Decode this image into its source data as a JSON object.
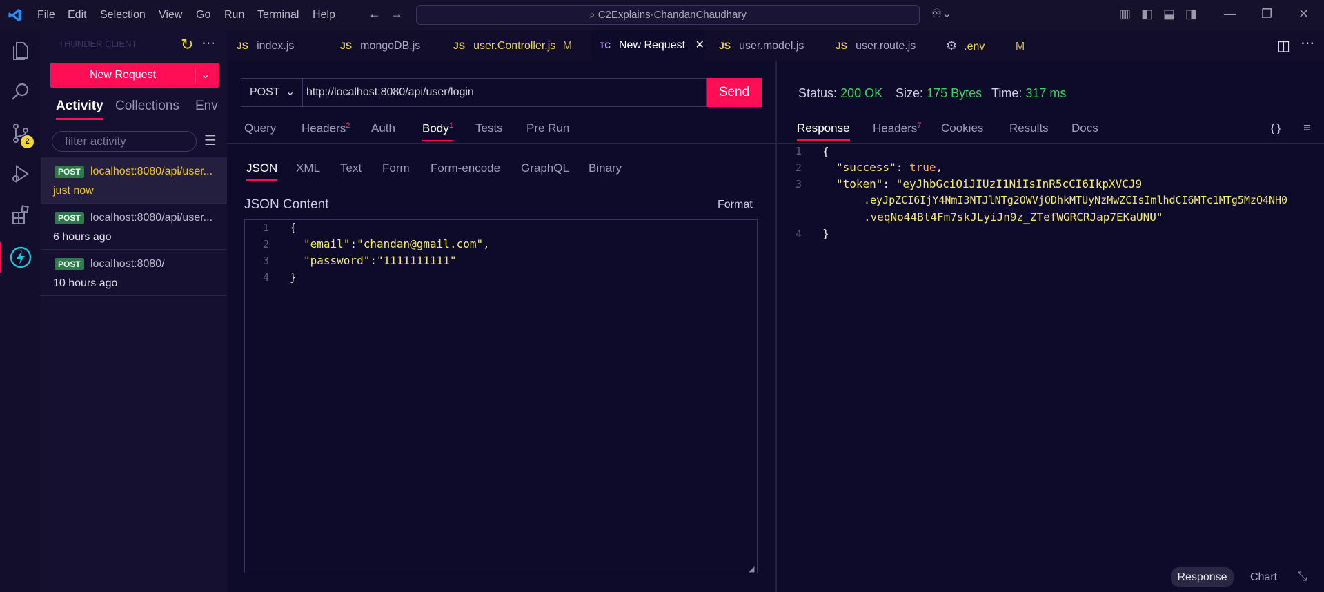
{
  "titlebar": {
    "menus": [
      "File",
      "Edit",
      "Selection",
      "View",
      "Go",
      "Run",
      "Terminal",
      "Help"
    ],
    "search": "C2Explains-ChandanChaudhary"
  },
  "activitybar": {
    "icons": [
      "files-icon",
      "search-icon",
      "source-control-icon",
      "run-debug-icon",
      "extensions-icon",
      "thunder-client-icon"
    ],
    "scm_badge": "2"
  },
  "sidebar": {
    "title": "THUNDER CLIENT",
    "new_request": "New Request",
    "tabs": [
      "Activity",
      "Collections",
      "Env"
    ],
    "filter_placeholder": "filter activity",
    "activity": [
      {
        "method": "POST",
        "url": "localhost:8080/api/user...",
        "time": "just now"
      },
      {
        "method": "POST",
        "url": "localhost:8080/api/user...",
        "time": "6 hours ago"
      },
      {
        "method": "POST",
        "url": "localhost:8080/",
        "time": "10 hours ago"
      }
    ]
  },
  "tabs": [
    {
      "prefix": "JS",
      "label": "index.js",
      "flag": ""
    },
    {
      "prefix": "JS",
      "label": "mongoDB.js",
      "flag": ""
    },
    {
      "prefix": "JS",
      "label": "user.Controller.js",
      "flag": "M"
    },
    {
      "prefix": "TC",
      "label": "New Request",
      "flag": ""
    },
    {
      "prefix": "JS",
      "label": "user.model.js",
      "flag": ""
    },
    {
      "prefix": "JS",
      "label": "user.route.js",
      "flag": ""
    },
    {
      "prefix": "",
      "label": ".env",
      "flag": "M"
    }
  ],
  "request": {
    "method": "POST",
    "url": "http://localhost:8080/api/user/login",
    "send": "Send",
    "tabs": [
      {
        "label": "Query",
        "count": ""
      },
      {
        "label": "Headers",
        "count": "2"
      },
      {
        "label": "Auth",
        "count": ""
      },
      {
        "label": "Body",
        "count": "1"
      },
      {
        "label": "Tests",
        "count": ""
      },
      {
        "label": "Pre Run",
        "count": ""
      }
    ],
    "body_tabs": [
      "JSON",
      "XML",
      "Text",
      "Form",
      "Form-encode",
      "GraphQL",
      "Binary"
    ],
    "content_label": "JSON Content",
    "format": "Format",
    "code_lines": [
      "1",
      "2",
      "3",
      "4"
    ],
    "email_key": "\"email\"",
    "email_value": "\"chandan@gmail.com\"",
    "password_key": "\"password\"",
    "password_value": "\"1111111111\""
  },
  "response": {
    "status_label": "Status:",
    "status_value": "200 OK",
    "size_label": "Size:",
    "size_value": "175 Bytes",
    "time_label": "Time:",
    "time_value": "317 ms",
    "tabs": [
      {
        "label": "Response",
        "count": ""
      },
      {
        "label": "Headers",
        "count": "7"
      },
      {
        "label": "Cookies",
        "count": ""
      },
      {
        "label": "Results",
        "count": ""
      },
      {
        "label": "Docs",
        "count": ""
      }
    ],
    "braces_icon": "{ }",
    "success_key": "\"success\"",
    "success_value": "true",
    "token_key": "\"token\"",
    "token_1": "\"eyJhbGciOiJIUzI1NiIsInR5cCI6IkpXVCJ9",
    "token_2": ".eyJpZCI6IjY4NmI3NTJlNTg2OWVjODhkMTUyNzMwZCIsImlhdCI6MTc1MTg5MzQ4NH0",
    "token_3": ".veqNo44Bt4Fm7skJLyiJn9z_ZTefWGRCRJap7EKaUNU\"",
    "toggle_response": "Response",
    "toggle_chart": "Chart"
  },
  "colors": {
    "accent": "#ff0e55",
    "success": "#3cd25e",
    "key": "#f4e96b",
    "bg": "#0d0a2a"
  }
}
